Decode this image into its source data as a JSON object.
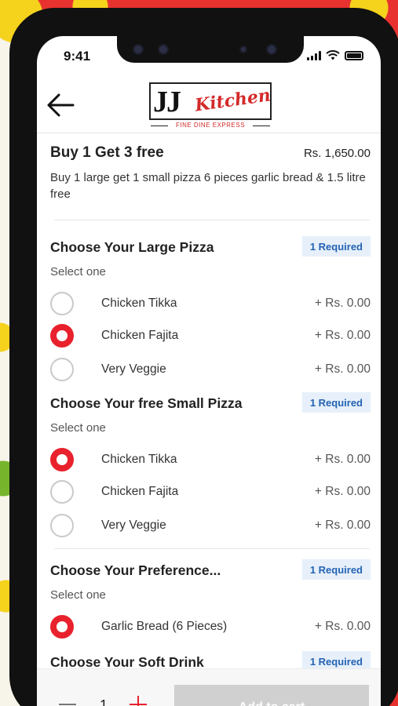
{
  "status_bar": {
    "time": "9:41"
  },
  "brand": {
    "logo_main": "JJ",
    "logo_script": "Kitchen",
    "logo_tagline": "FINE DINE EXPRESS"
  },
  "deal": {
    "title": "Buy 1 Get 3 free",
    "price": "Rs. 1,650.00",
    "description": "Buy 1 large get 1 small pizza 6 pieces garlic bread & 1.5 litre free"
  },
  "groups": [
    {
      "title": "Choose Your Large Pizza",
      "badge": "1 Required",
      "subtitle": "Select one",
      "options": [
        {
          "label": "Chicken Tikka",
          "price": "+ Rs. 0.00",
          "selected": false
        },
        {
          "label": "Chicken Fajita",
          "price": "+ Rs. 0.00",
          "selected": true
        },
        {
          "label": "Very Veggie",
          "price": "+ Rs. 0.00",
          "selected": false
        }
      ]
    },
    {
      "title": "Choose Your free Small Pizza",
      "badge": "1 Required",
      "subtitle": "Select one",
      "options": [
        {
          "label": "Chicken Tikka",
          "price": "+ Rs. 0.00",
          "selected": true
        },
        {
          "label": "Chicken Fajita",
          "price": "+ Rs. 0.00",
          "selected": false
        },
        {
          "label": "Very Veggie",
          "price": "+ Rs. 0.00",
          "selected": false
        }
      ]
    },
    {
      "title": "Choose Your Preference...",
      "badge": "1 Required",
      "subtitle": "Select one",
      "options": [
        {
          "label": "Garlic Bread (6 Pieces)",
          "price": "+ Rs. 0.00",
          "selected": true
        }
      ]
    },
    {
      "title": "Choose Your Soft Drink",
      "badge": "1 Required"
    }
  ],
  "footer": {
    "quantity": "1",
    "add_to_cart": "Add to cart"
  },
  "colors": {
    "accent": "#e8212c",
    "badge_bg": "#e7f0fa",
    "badge_text": "#2463b3",
    "cart_disabled": "#d0d0d0"
  }
}
